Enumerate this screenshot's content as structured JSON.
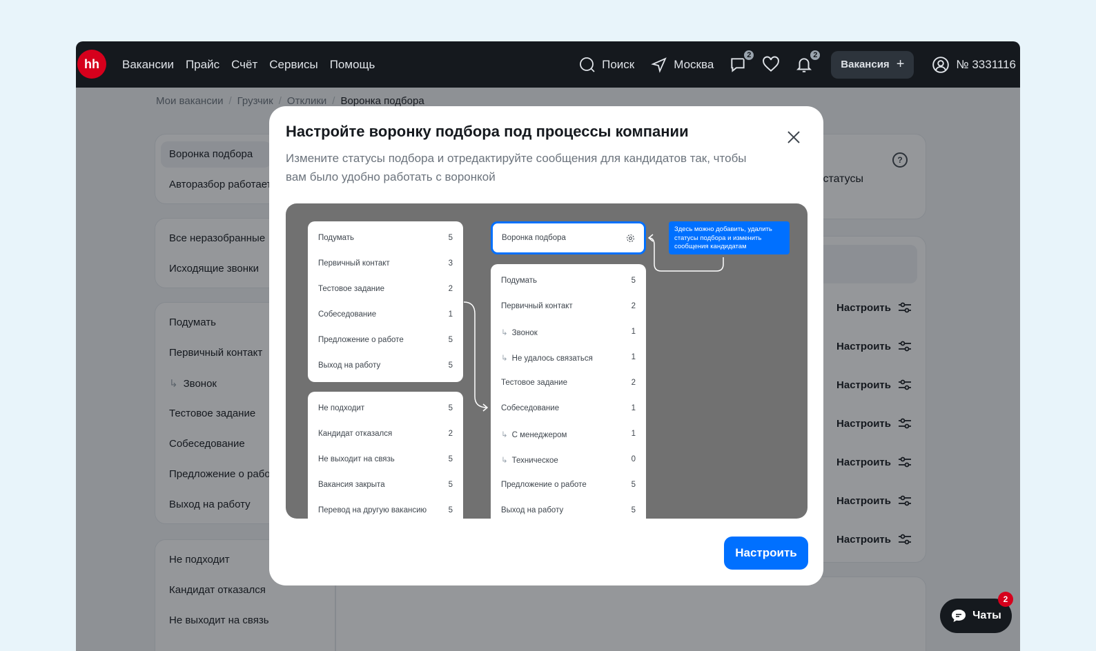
{
  "header": {
    "logo": "hh",
    "nav": [
      "Вакансии",
      "Прайс",
      "Счёт",
      "Сервисы",
      "Помощь"
    ],
    "search_label": "Поиск",
    "city_label": "Москва",
    "messages_badge": "2",
    "notifications_badge": "2",
    "vacancy_button": "Вакансия",
    "account_id": "№ 3331116"
  },
  "breadcrumb": [
    "Мои вакансии",
    "Грузчик",
    "Отклики",
    "Воронка подбора"
  ],
  "sidebar": {
    "group1": [
      "Воронка подбора",
      "Авторазбор работает"
    ],
    "group2": [
      "Все неразобранные",
      "Исходящие звонки"
    ],
    "group3": [
      "Подумать",
      "Первичный контакт",
      "Звонок",
      "Тестовое задание",
      "Собеседование",
      "Предложение о работе",
      "Выход на работу"
    ],
    "group4": [
      "Не подходит",
      "Кандидат отказался",
      "Не выходит на связь"
    ]
  },
  "main": {
    "statuses_text": "дстатусы",
    "configure_label": "Настроить"
  },
  "modal": {
    "title": "Настройте воронку подбора под процессы компании",
    "description": "Измените статусы подбора и отредактируйте сообщения для кандидатов так, чтобы вам было удобно работать с воронкой",
    "button": "Настроить",
    "illustration": {
      "left_top": [
        {
          "label": "Подумать",
          "count": "5"
        },
        {
          "label": "Первичный контакт",
          "count": "3"
        },
        {
          "label": "Тестовое задание",
          "count": "2"
        },
        {
          "label": "Собеседование",
          "count": "1"
        },
        {
          "label": "Предложение о работе",
          "count": "5"
        },
        {
          "label": "Выход на работу",
          "count": "5"
        }
      ],
      "left_bottom": [
        {
          "label": "Не подходит",
          "count": "5"
        },
        {
          "label": "Кандидат отказался",
          "count": "2"
        },
        {
          "label": "Не выходит на связь",
          "count": "5"
        },
        {
          "label": "Вакансия закрыта",
          "count": "5"
        },
        {
          "label": "Перевод на другую вакансию",
          "count": "5"
        }
      ],
      "funnel_label": "Воронка подбора",
      "tip": "Здесь можно добавить, удалить статусы подбора и изменить сообщения кандидатам",
      "right_list": [
        {
          "label": "Подумать",
          "count": "5",
          "sub": false
        },
        {
          "label": "Первичный контакт",
          "count": "2",
          "sub": false
        },
        {
          "label": "Звонок",
          "count": "1",
          "sub": true
        },
        {
          "label": "Не удалось связаться",
          "count": "1",
          "sub": true
        },
        {
          "label": "Тестовое задание",
          "count": "2",
          "sub": false
        },
        {
          "label": "Собеседование",
          "count": "1",
          "sub": false
        },
        {
          "label": "С менеджером",
          "count": "1",
          "sub": true
        },
        {
          "label": "Техническое",
          "count": "0",
          "sub": true
        },
        {
          "label": "Предложение о работе",
          "count": "5",
          "sub": false
        },
        {
          "label": "Выход на работу",
          "count": "5",
          "sub": false
        }
      ]
    }
  },
  "chats": {
    "label": "Чаты",
    "badge": "2"
  }
}
